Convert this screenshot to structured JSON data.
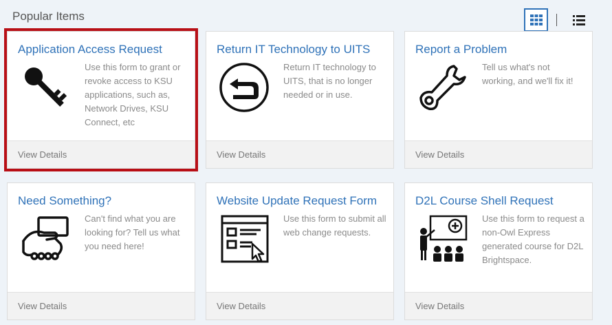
{
  "section_title": "Popular Items",
  "view_toggle": {
    "grid_icon": "grid-icon",
    "list_icon": "list-icon"
  },
  "cards": [
    {
      "title": "Application Access Request",
      "desc": "Use this form to grant or revoke access to KSU applications, such as, Network Drives, KSU Connect, etc",
      "footer": "View Details",
      "icon": "key-icon"
    },
    {
      "title": "Return IT Technology to UITS",
      "desc": "Return IT technology to UITS, that is no longer needed or in use.",
      "footer": "View Details",
      "icon": "return-arrow-icon"
    },
    {
      "title": "Report a Problem",
      "desc": "Tell us what's not working, and we'll fix it!",
      "footer": "View Details",
      "icon": "wrench-icon"
    },
    {
      "title": "Need Something?",
      "desc": "Can't find what you are looking for? Tell us what you need here!",
      "footer": "View Details",
      "icon": "hand-card-icon"
    },
    {
      "title": "Website Update Request Form",
      "desc": "Use this form to submit all web change requests.",
      "footer": "View Details",
      "icon": "web-form-icon"
    },
    {
      "title": "D2L Course Shell Request",
      "desc": "Use this form to request a non-Owl Express generated course for D2L Brightspace.",
      "footer": "View Details",
      "icon": "classroom-icon"
    }
  ],
  "colors": {
    "accent": "#2f72b8",
    "highlight": "#b80f16"
  }
}
